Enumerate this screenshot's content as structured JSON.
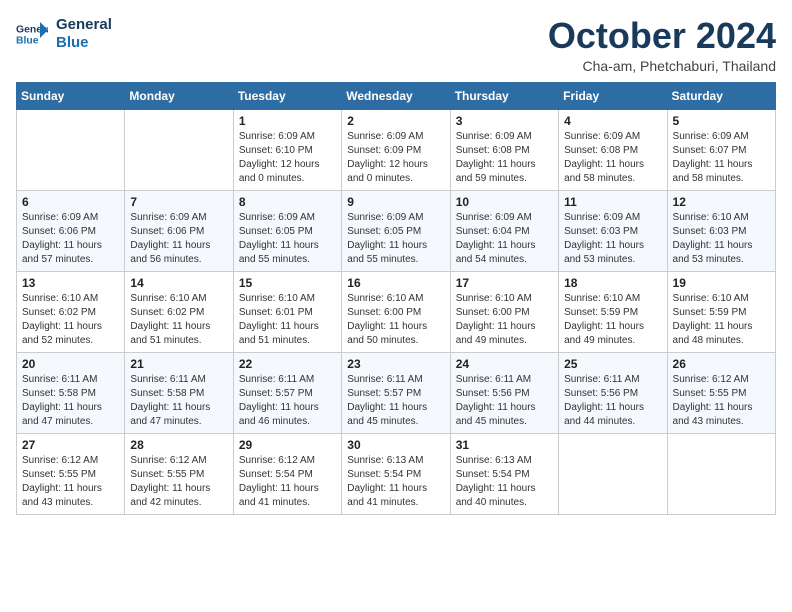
{
  "header": {
    "logo_line1": "General",
    "logo_line2": "Blue",
    "month": "October 2024",
    "location": "Cha-am, Phetchaburi, Thailand"
  },
  "days_of_week": [
    "Sunday",
    "Monday",
    "Tuesday",
    "Wednesday",
    "Thursday",
    "Friday",
    "Saturday"
  ],
  "weeks": [
    [
      {
        "day": "",
        "sunrise": "",
        "sunset": "",
        "daylight": ""
      },
      {
        "day": "",
        "sunrise": "",
        "sunset": "",
        "daylight": ""
      },
      {
        "day": "1",
        "sunrise": "Sunrise: 6:09 AM",
        "sunset": "Sunset: 6:10 PM",
        "daylight": "Daylight: 12 hours and 0 minutes."
      },
      {
        "day": "2",
        "sunrise": "Sunrise: 6:09 AM",
        "sunset": "Sunset: 6:09 PM",
        "daylight": "Daylight: 12 hours and 0 minutes."
      },
      {
        "day": "3",
        "sunrise": "Sunrise: 6:09 AM",
        "sunset": "Sunset: 6:08 PM",
        "daylight": "Daylight: 11 hours and 59 minutes."
      },
      {
        "day": "4",
        "sunrise": "Sunrise: 6:09 AM",
        "sunset": "Sunset: 6:08 PM",
        "daylight": "Daylight: 11 hours and 58 minutes."
      },
      {
        "day": "5",
        "sunrise": "Sunrise: 6:09 AM",
        "sunset": "Sunset: 6:07 PM",
        "daylight": "Daylight: 11 hours and 58 minutes."
      }
    ],
    [
      {
        "day": "6",
        "sunrise": "Sunrise: 6:09 AM",
        "sunset": "Sunset: 6:06 PM",
        "daylight": "Daylight: 11 hours and 57 minutes."
      },
      {
        "day": "7",
        "sunrise": "Sunrise: 6:09 AM",
        "sunset": "Sunset: 6:06 PM",
        "daylight": "Daylight: 11 hours and 56 minutes."
      },
      {
        "day": "8",
        "sunrise": "Sunrise: 6:09 AM",
        "sunset": "Sunset: 6:05 PM",
        "daylight": "Daylight: 11 hours and 55 minutes."
      },
      {
        "day": "9",
        "sunrise": "Sunrise: 6:09 AM",
        "sunset": "Sunset: 6:05 PM",
        "daylight": "Daylight: 11 hours and 55 minutes."
      },
      {
        "day": "10",
        "sunrise": "Sunrise: 6:09 AM",
        "sunset": "Sunset: 6:04 PM",
        "daylight": "Daylight: 11 hours and 54 minutes."
      },
      {
        "day": "11",
        "sunrise": "Sunrise: 6:09 AM",
        "sunset": "Sunset: 6:03 PM",
        "daylight": "Daylight: 11 hours and 53 minutes."
      },
      {
        "day": "12",
        "sunrise": "Sunrise: 6:10 AM",
        "sunset": "Sunset: 6:03 PM",
        "daylight": "Daylight: 11 hours and 53 minutes."
      }
    ],
    [
      {
        "day": "13",
        "sunrise": "Sunrise: 6:10 AM",
        "sunset": "Sunset: 6:02 PM",
        "daylight": "Daylight: 11 hours and 52 minutes."
      },
      {
        "day": "14",
        "sunrise": "Sunrise: 6:10 AM",
        "sunset": "Sunset: 6:02 PM",
        "daylight": "Daylight: 11 hours and 51 minutes."
      },
      {
        "day": "15",
        "sunrise": "Sunrise: 6:10 AM",
        "sunset": "Sunset: 6:01 PM",
        "daylight": "Daylight: 11 hours and 51 minutes."
      },
      {
        "day": "16",
        "sunrise": "Sunrise: 6:10 AM",
        "sunset": "Sunset: 6:00 PM",
        "daylight": "Daylight: 11 hours and 50 minutes."
      },
      {
        "day": "17",
        "sunrise": "Sunrise: 6:10 AM",
        "sunset": "Sunset: 6:00 PM",
        "daylight": "Daylight: 11 hours and 49 minutes."
      },
      {
        "day": "18",
        "sunrise": "Sunrise: 6:10 AM",
        "sunset": "Sunset: 5:59 PM",
        "daylight": "Daylight: 11 hours and 49 minutes."
      },
      {
        "day": "19",
        "sunrise": "Sunrise: 6:10 AM",
        "sunset": "Sunset: 5:59 PM",
        "daylight": "Daylight: 11 hours and 48 minutes."
      }
    ],
    [
      {
        "day": "20",
        "sunrise": "Sunrise: 6:11 AM",
        "sunset": "Sunset: 5:58 PM",
        "daylight": "Daylight: 11 hours and 47 minutes."
      },
      {
        "day": "21",
        "sunrise": "Sunrise: 6:11 AM",
        "sunset": "Sunset: 5:58 PM",
        "daylight": "Daylight: 11 hours and 47 minutes."
      },
      {
        "day": "22",
        "sunrise": "Sunrise: 6:11 AM",
        "sunset": "Sunset: 5:57 PM",
        "daylight": "Daylight: 11 hours and 46 minutes."
      },
      {
        "day": "23",
        "sunrise": "Sunrise: 6:11 AM",
        "sunset": "Sunset: 5:57 PM",
        "daylight": "Daylight: 11 hours and 45 minutes."
      },
      {
        "day": "24",
        "sunrise": "Sunrise: 6:11 AM",
        "sunset": "Sunset: 5:56 PM",
        "daylight": "Daylight: 11 hours and 45 minutes."
      },
      {
        "day": "25",
        "sunrise": "Sunrise: 6:11 AM",
        "sunset": "Sunset: 5:56 PM",
        "daylight": "Daylight: 11 hours and 44 minutes."
      },
      {
        "day": "26",
        "sunrise": "Sunrise: 6:12 AM",
        "sunset": "Sunset: 5:55 PM",
        "daylight": "Daylight: 11 hours and 43 minutes."
      }
    ],
    [
      {
        "day": "27",
        "sunrise": "Sunrise: 6:12 AM",
        "sunset": "Sunset: 5:55 PM",
        "daylight": "Daylight: 11 hours and 43 minutes."
      },
      {
        "day": "28",
        "sunrise": "Sunrise: 6:12 AM",
        "sunset": "Sunset: 5:55 PM",
        "daylight": "Daylight: 11 hours and 42 minutes."
      },
      {
        "day": "29",
        "sunrise": "Sunrise: 6:12 AM",
        "sunset": "Sunset: 5:54 PM",
        "daylight": "Daylight: 11 hours and 41 minutes."
      },
      {
        "day": "30",
        "sunrise": "Sunrise: 6:13 AM",
        "sunset": "Sunset: 5:54 PM",
        "daylight": "Daylight: 11 hours and 41 minutes."
      },
      {
        "day": "31",
        "sunrise": "Sunrise: 6:13 AM",
        "sunset": "Sunset: 5:54 PM",
        "daylight": "Daylight: 11 hours and 40 minutes."
      },
      {
        "day": "",
        "sunrise": "",
        "sunset": "",
        "daylight": ""
      },
      {
        "day": "",
        "sunrise": "",
        "sunset": "",
        "daylight": ""
      }
    ]
  ]
}
